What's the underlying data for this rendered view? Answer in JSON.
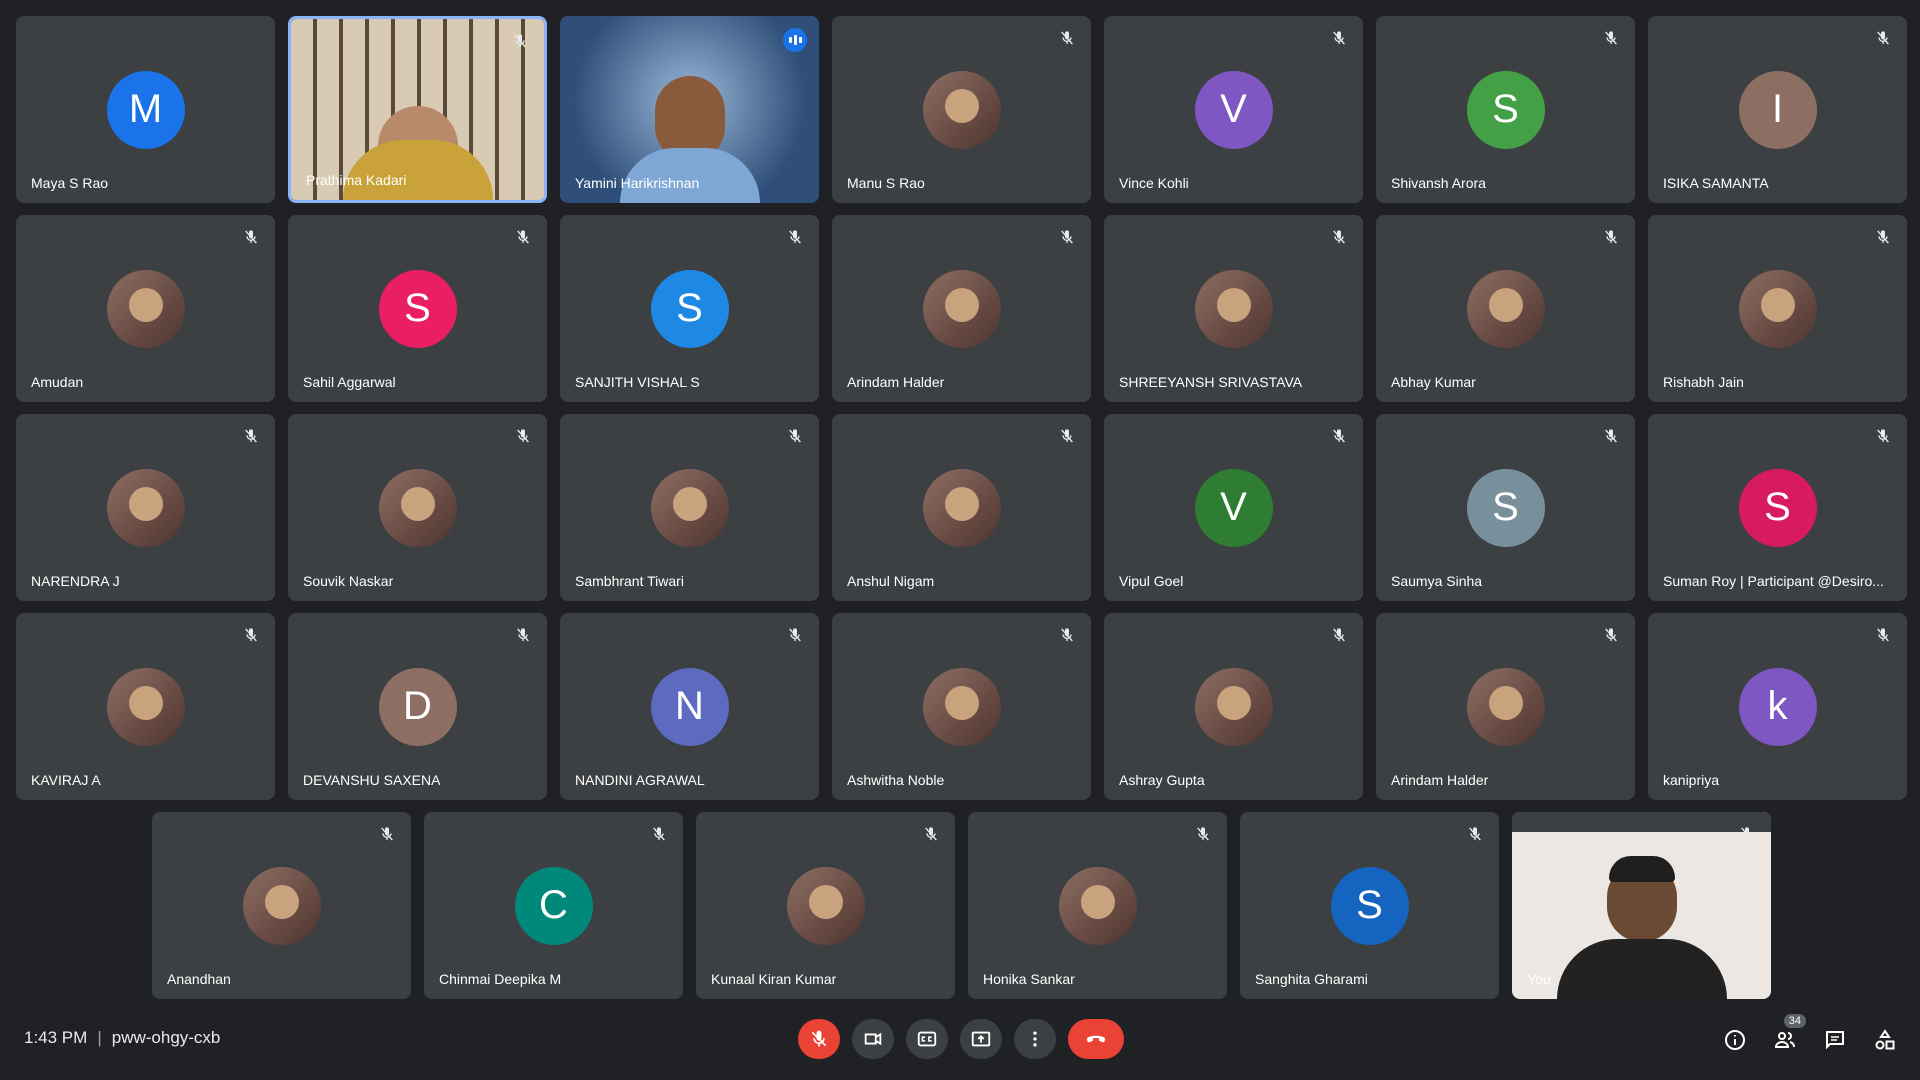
{
  "meeting": {
    "time": "1:43 PM",
    "separator": "|",
    "code": "pww-ohgy-cxb"
  },
  "people_count": "34",
  "colors": {
    "background": "#202124",
    "tile": "#3c4043",
    "active_border": "#8ab4f8",
    "danger": "#ea4335"
  },
  "participants": [
    {
      "name": "Maya S Rao",
      "type": "letter",
      "letter": "M",
      "color": "#1a73e8",
      "mic": "none"
    },
    {
      "name": "Prathima Kadari",
      "type": "video",
      "mic": "muted",
      "active": true,
      "scene": "bookshelf"
    },
    {
      "name": "Yamini Harikrishnan",
      "type": "video",
      "mic": "speaking",
      "scene": "space"
    },
    {
      "name": "Manu S Rao",
      "type": "photo",
      "mic": "muted"
    },
    {
      "name": "Vince Kohli",
      "type": "letter",
      "letter": "V",
      "color": "#7e57c2",
      "mic": "muted"
    },
    {
      "name": "Shivansh Arora",
      "type": "letter",
      "letter": "S",
      "color": "#43a047",
      "mic": "muted"
    },
    {
      "name": "ISIKA SAMANTA",
      "type": "letter",
      "letter": "I",
      "color": "#8d6e63",
      "mic": "muted"
    },
    {
      "name": "Amudan",
      "type": "photo",
      "mic": "muted"
    },
    {
      "name": "Sahil Aggarwal",
      "type": "letter",
      "letter": "S",
      "color": "#e91e63",
      "mic": "muted"
    },
    {
      "name": "SANJITH VISHAL S",
      "type": "letter",
      "letter": "S",
      "color": "#1e88e5",
      "mic": "muted"
    },
    {
      "name": "Arindam Halder",
      "type": "photo",
      "mic": "muted"
    },
    {
      "name": "SHREEYANSH SRIVASTAVA",
      "type": "photo",
      "mic": "muted"
    },
    {
      "name": "Abhay Kumar",
      "type": "photo",
      "mic": "muted"
    },
    {
      "name": "Rishabh Jain",
      "type": "photo",
      "mic": "muted"
    },
    {
      "name": "NARENDRA J",
      "type": "photo",
      "mic": "muted"
    },
    {
      "name": "Souvik Naskar",
      "type": "photo",
      "mic": "muted"
    },
    {
      "name": "Sambhrant Tiwari",
      "type": "photo",
      "mic": "muted"
    },
    {
      "name": "Anshul Nigam",
      "type": "photo",
      "mic": "muted"
    },
    {
      "name": "Vipul Goel",
      "type": "letter",
      "letter": "V",
      "color": "#2e7d32",
      "mic": "muted"
    },
    {
      "name": "Saumya Sinha",
      "type": "letter",
      "letter": "S",
      "color": "#78909c",
      "mic": "muted"
    },
    {
      "name": "Suman Roy | Participant @Desiro...",
      "type": "letter",
      "letter": "S",
      "color": "#d81b60",
      "mic": "muted"
    },
    {
      "name": "KAVIRAJ A",
      "type": "photo",
      "mic": "muted"
    },
    {
      "name": "DEVANSHU SAXENA",
      "type": "letter",
      "letter": "D",
      "color": "#8d6e63",
      "mic": "muted"
    },
    {
      "name": "NANDINI AGRAWAL",
      "type": "letter",
      "letter": "N",
      "color": "#5c6bc0",
      "mic": "muted"
    },
    {
      "name": "Ashwitha Noble",
      "type": "photo",
      "mic": "muted"
    },
    {
      "name": "Ashray Gupta",
      "type": "photo",
      "mic": "muted"
    },
    {
      "name": "Arindam Halder",
      "type": "photo",
      "mic": "muted"
    },
    {
      "name": "kanipriya",
      "type": "letter",
      "letter": "k",
      "color": "#7e57c2",
      "mic": "muted"
    },
    {
      "name": "Anandhan",
      "type": "photo",
      "mic": "muted"
    },
    {
      "name": "Chinmai Deepika M",
      "type": "letter",
      "letter": "C",
      "color": "#00897b",
      "mic": "muted"
    },
    {
      "name": "Kunaal Kiran Kumar",
      "type": "photo",
      "mic": "muted"
    },
    {
      "name": "Honika Sankar",
      "type": "photo",
      "mic": "muted"
    },
    {
      "name": "Sanghita Gharami",
      "type": "letter",
      "letter": "S",
      "color": "#1565c0",
      "mic": "muted"
    },
    {
      "name": "You",
      "type": "video",
      "mic": "muted",
      "scene": "self"
    }
  ],
  "controls": [
    {
      "id": "mic",
      "icon": "mic-off-icon",
      "style": "red"
    },
    {
      "id": "camera",
      "icon": "videocam-icon",
      "style": "normal"
    },
    {
      "id": "captions",
      "icon": "closed-captions-icon",
      "style": "normal"
    },
    {
      "id": "present",
      "icon": "present-screen-icon",
      "style": "normal"
    },
    {
      "id": "more",
      "icon": "more-vert-icon",
      "style": "normal"
    },
    {
      "id": "leave",
      "icon": "call-end-icon",
      "style": "end"
    }
  ],
  "right_controls": [
    {
      "id": "info",
      "icon": "info-icon"
    },
    {
      "id": "people",
      "icon": "people-icon"
    },
    {
      "id": "chat",
      "icon": "chat-icon"
    },
    {
      "id": "activities",
      "icon": "activities-icon"
    }
  ]
}
